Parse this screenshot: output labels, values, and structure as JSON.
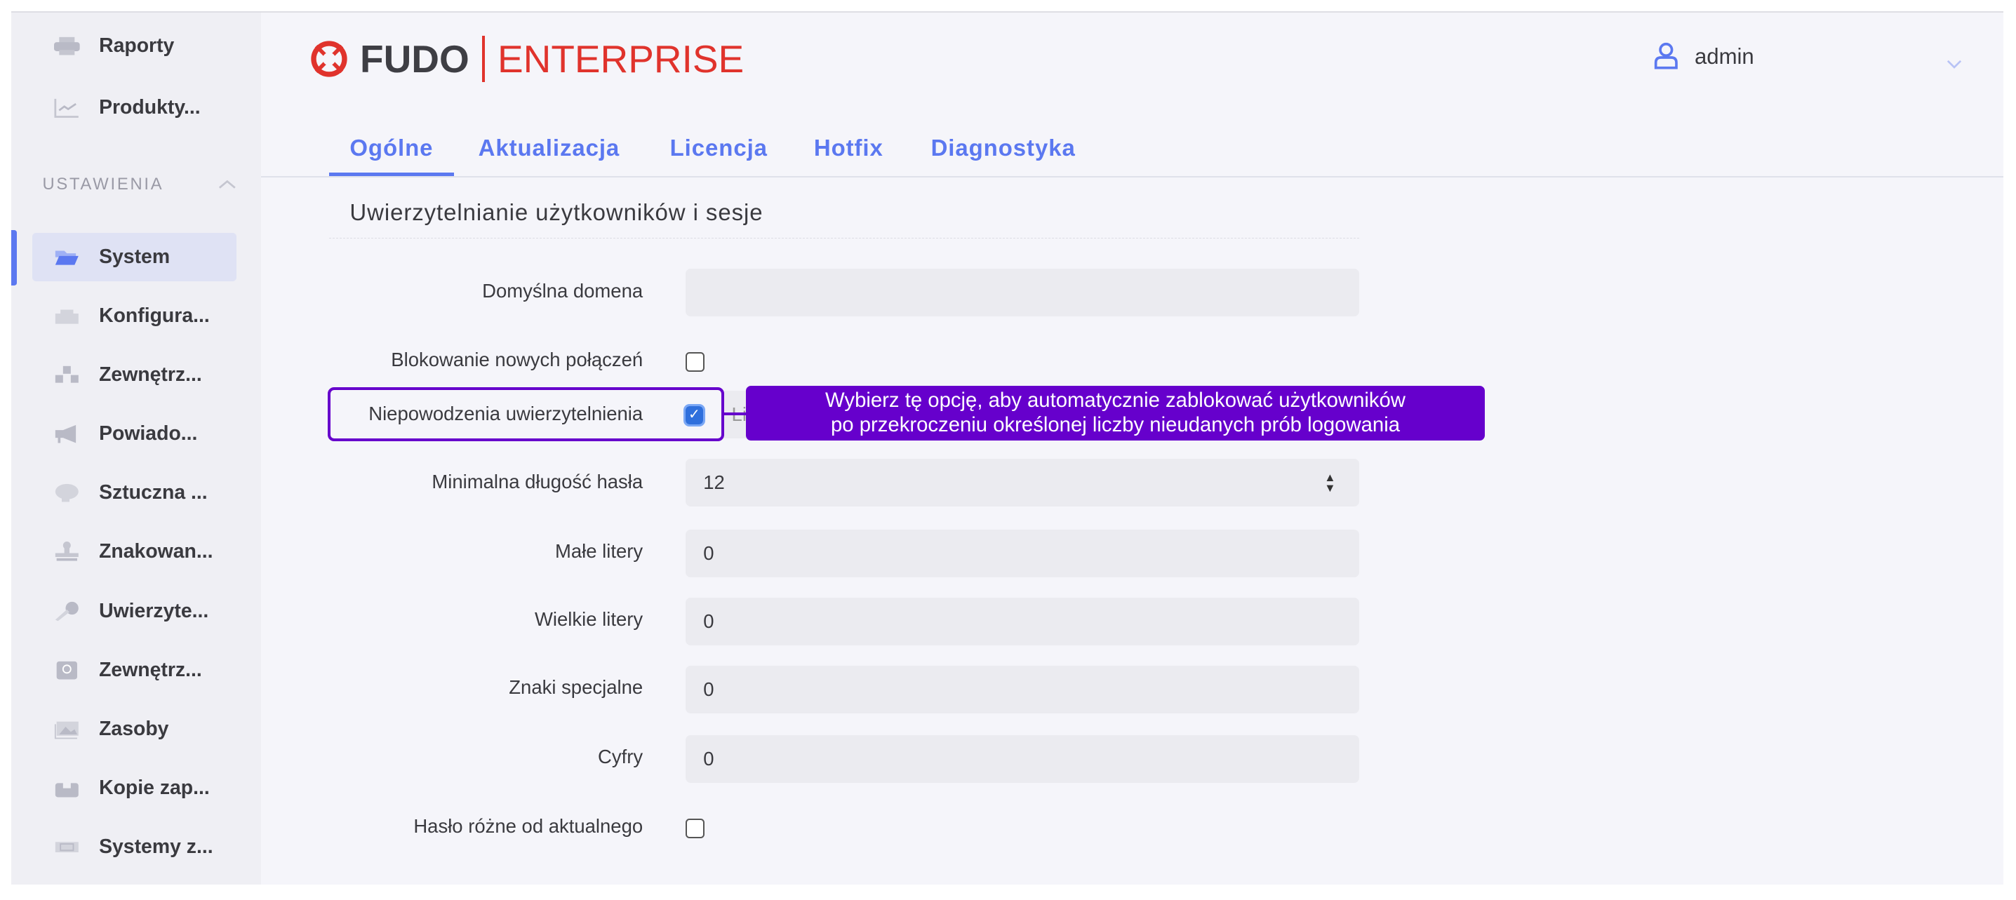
{
  "sidebar": {
    "top_items": [
      {
        "label": "Raporty",
        "icon": "printer-icon"
      },
      {
        "label": "Produkty...",
        " icon": "chart-icon"
      }
    ],
    "section_label": "USTAWIENIA",
    "items": [
      {
        "label": "System",
        "icon": "folder-open-icon",
        "active": true
      },
      {
        "label": "Konfigura...",
        "icon": "network-icon"
      },
      {
        "label": "Zewnętrz...",
        "icon": "boxes-icon"
      },
      {
        "label": "Powiado...",
        "icon": "megaphone-icon"
      },
      {
        "label": "Sztuczna ...",
        "icon": "brain-icon"
      },
      {
        "label": "Znakowan...",
        "icon": "stamp-icon"
      },
      {
        "label": "Uwierzyte...",
        "icon": "key-icon"
      },
      {
        "label": "Zewnętrz...",
        "icon": "passport-icon"
      },
      {
        "label": "Zasoby",
        "icon": "image-icon"
      },
      {
        "label": "Kopie zap...",
        "icon": "archive-icon"
      },
      {
        "label": "Systemy z...",
        "icon": "ticket-icon"
      }
    ]
  },
  "header": {
    "logo_fudo": "FUDO",
    "logo_enterprise": "ENTERPRISE",
    "user": "admin"
  },
  "tabs": [
    {
      "label": "Ogólne",
      "active": true
    },
    {
      "label": "Aktualizacja"
    },
    {
      "label": "Licencja"
    },
    {
      "label": "Hotfix"
    },
    {
      "label": "Diagnostyka"
    }
  ],
  "form": {
    "title": "Uwierzytelnianie użytkowników i sesje",
    "default_domain": {
      "label": "Domyślna domena",
      "value": ""
    },
    "block_new": {
      "label": "Blokowanie nowych połączeń",
      "checked": false
    },
    "auth_failures": {
      "label": "Niepowodzenia uwierzytelnienia",
      "checked": true,
      "hidden_field_text": "Li"
    },
    "min_length": {
      "label": "Minimalna długość hasła",
      "value": "12"
    },
    "lowercase": {
      "label": "Małe litery",
      "value": "0"
    },
    "uppercase": {
      "label": "Wielkie litery",
      "value": "0"
    },
    "special": {
      "label": "Znaki specjalne",
      "value": "0"
    },
    "digits": {
      "label": "Cyfry",
      "value": "0"
    },
    "differs": {
      "label": "Hasło różne od aktualnego",
      "checked": false
    }
  },
  "tooltip": {
    "line1": "Wybierz tę opcję, aby automatycznie zablokować użytkowników",
    "line2": "po przekroczeniu określonej liczby nieudanych prób logowania"
  },
  "colors": {
    "accent": "#5b78f0",
    "brand_red": "#e0332c",
    "highlight": "#6600cc"
  }
}
